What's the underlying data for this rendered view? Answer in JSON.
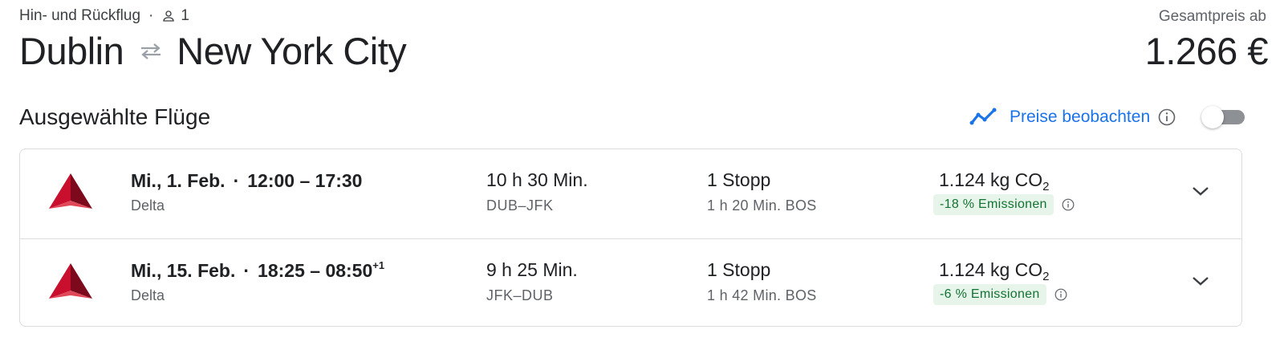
{
  "header": {
    "trip_type": "Hin- und Rückflug",
    "dot": "·",
    "passengers": "1",
    "origin": "Dublin",
    "destination": "New York City",
    "price_label": "Gesamtpreis ab",
    "price": "1.266 €"
  },
  "section": {
    "title": "Ausgewählte Flüge",
    "watch_label": "Preise beobachten",
    "watch_enabled": false
  },
  "flights": [
    {
      "date": "Mi., 1. Feb.",
      "sep": "·",
      "times": "12:00 – 17:30",
      "next_day": "",
      "airline": "Delta",
      "duration": "10 h 30 Min.",
      "airports": "DUB–JFK",
      "stops": "1 Stopp",
      "layover": "1 h 20 Min. BOS",
      "co2_value": "1.124 kg CO",
      "co2_sub": "2",
      "emissions": "-18 % Emissionen"
    },
    {
      "date": "Mi., 15. Feb.",
      "sep": "·",
      "times": "18:25 – 08:50",
      "next_day": "+1",
      "airline": "Delta",
      "duration": "9 h 25 Min.",
      "airports": "JFK–DUB",
      "stops": "1 Stopp",
      "layover": "1 h 42 Min. BOS",
      "co2_value": "1.124 kg CO",
      "co2_sub": "2",
      "emissions": "-6 % Emissionen"
    }
  ],
  "colors": {
    "accent": "#1a73e8",
    "delta_red": "#c8102e",
    "badge_bg": "#e6f4ea",
    "badge_text": "#137333"
  }
}
